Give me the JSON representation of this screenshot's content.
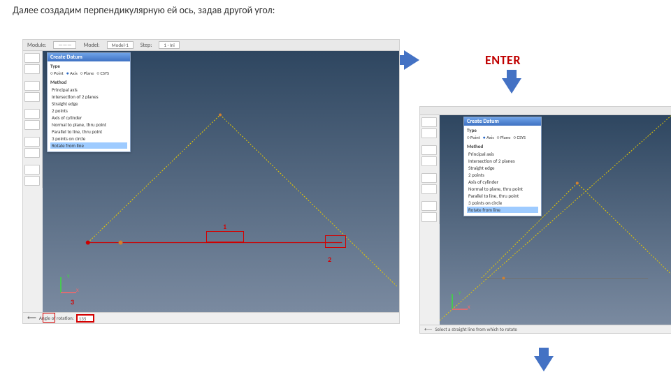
{
  "caption": "Далее создадим перпендикулярную ей ось, задав другой угол:",
  "enter_label": "ENTER",
  "toolbar": {
    "module_lbl": "Module:",
    "module_sel": "———",
    "model_lbl": "Model:",
    "model_sel": "Model-1",
    "step_lbl": "Step:",
    "step_sel": "1 · Ini"
  },
  "panel": {
    "title": "Create Datum",
    "type_lbl": "Type",
    "radios": [
      "Point",
      "Axis",
      "Plane",
      "CSYS"
    ],
    "radio_on": 1,
    "method_lbl": "Method",
    "methods": [
      "Principal axis",
      "Intersection of 2 planes",
      "Straight edge",
      "2 points",
      "Axis of cylinder",
      "Normal to plane, thru point",
      "Parallel to line, thru point",
      "3 points on circle",
      "Rotate from line"
    ]
  },
  "status_a": {
    "label": "Angle of rotation:",
    "value": "135"
  },
  "status_b": {
    "text": "Select a straight line from which to rotate"
  },
  "annots": {
    "n1": "1",
    "n2": "2",
    "n3": "3"
  },
  "triad": {
    "x": "X",
    "y": "Y"
  }
}
